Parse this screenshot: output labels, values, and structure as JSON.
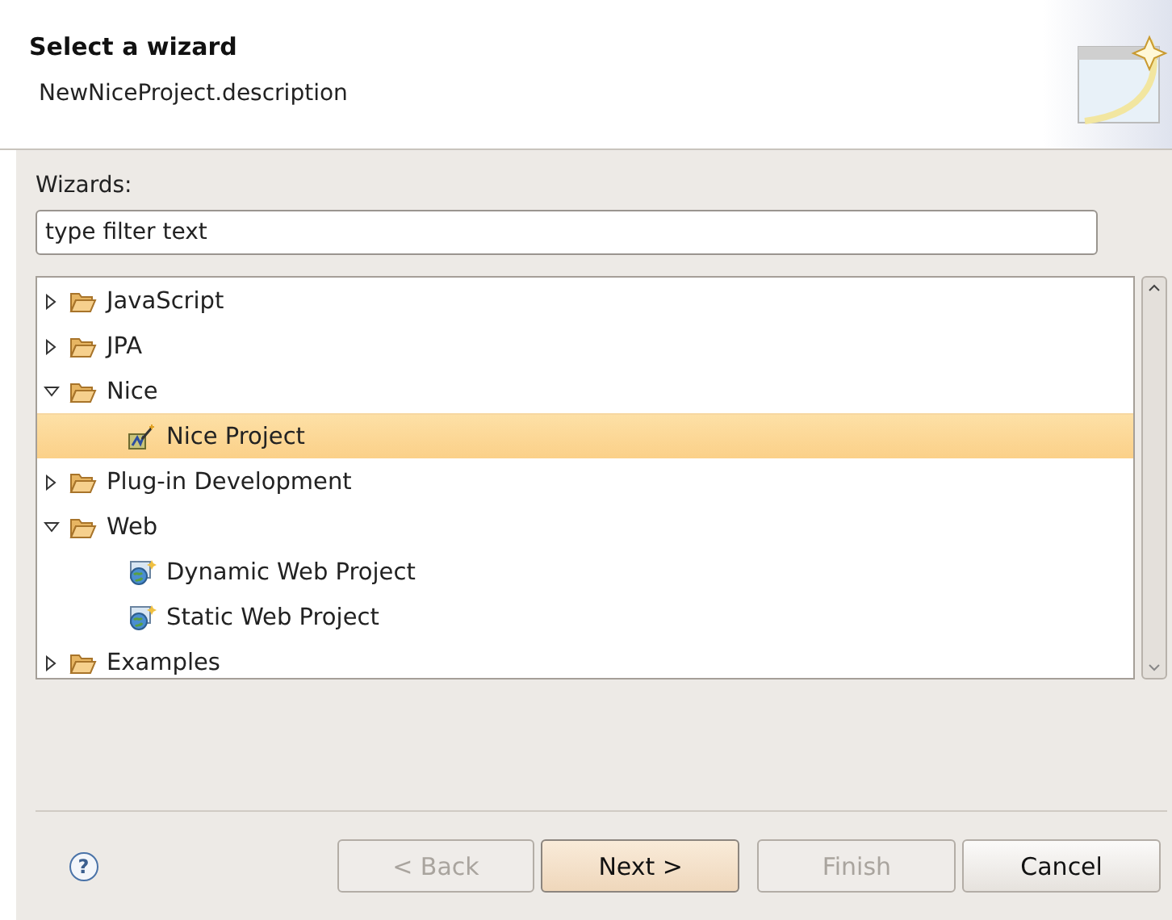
{
  "header": {
    "title": "Select a wizard",
    "description": "NewNiceProject.description"
  },
  "wizards": {
    "label": "Wizards:",
    "filter": {
      "placeholder": "type filter text"
    },
    "tree": [
      {
        "label": "JavaScript",
        "kind": "folder",
        "expanded": false,
        "selected": false
      },
      {
        "label": "JPA",
        "kind": "folder",
        "expanded": false,
        "selected": false
      },
      {
        "label": "Nice",
        "kind": "folder",
        "expanded": true,
        "selected": false,
        "children": [
          {
            "label": "Nice Project",
            "kind": "nice",
            "selected": true
          }
        ]
      },
      {
        "label": "Plug-in Development",
        "kind": "folder",
        "expanded": false,
        "selected": false
      },
      {
        "label": "Web",
        "kind": "folder",
        "expanded": true,
        "selected": false,
        "children": [
          {
            "label": "Dynamic Web Project",
            "kind": "web",
            "selected": false
          },
          {
            "label": "Static Web Project",
            "kind": "web",
            "selected": false
          }
        ]
      },
      {
        "label": "Examples",
        "kind": "folder",
        "expanded": false,
        "selected": false
      }
    ]
  },
  "help": {
    "label": "?"
  },
  "buttons": [
    {
      "label": "< Back",
      "disabled": true,
      "default": false
    },
    {
      "label": "Next >",
      "disabled": false,
      "default": true
    },
    {
      "label": "Finish",
      "disabled": true,
      "default": false
    },
    {
      "label": "Cancel",
      "disabled": false,
      "default": false
    }
  ]
}
